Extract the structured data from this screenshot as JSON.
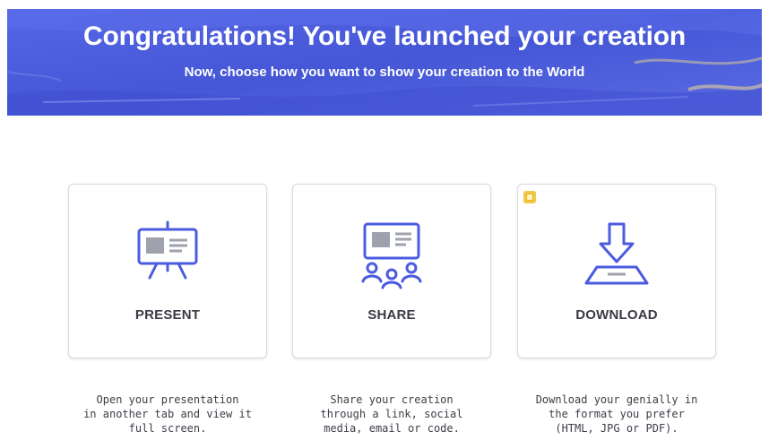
{
  "banner": {
    "title": "Congratulations! You've launched your creation",
    "subtitle": "Now, choose how you want to show your creation to the World"
  },
  "options": [
    {
      "label": "PRESENT",
      "icon": "presentation-board-icon",
      "description": "Open your presentation\nin another tab and view it\nfull screen."
    },
    {
      "label": "SHARE",
      "icon": "share-audience-icon",
      "description": "Share your creation\nthrough a link, social\nmedia, email or code."
    },
    {
      "label": "DOWNLOAD",
      "icon": "download-tray-icon",
      "premium_badge_icon": "premium-crown-icon",
      "description": "Download your genially in\nthe format you prefer\n(HTML, JPG or PDF)."
    }
  ],
  "colors": {
    "banner_blue": "#4d5fdc",
    "icon_blue": "#4b5be0",
    "premium_gold": "#e8b51f"
  }
}
